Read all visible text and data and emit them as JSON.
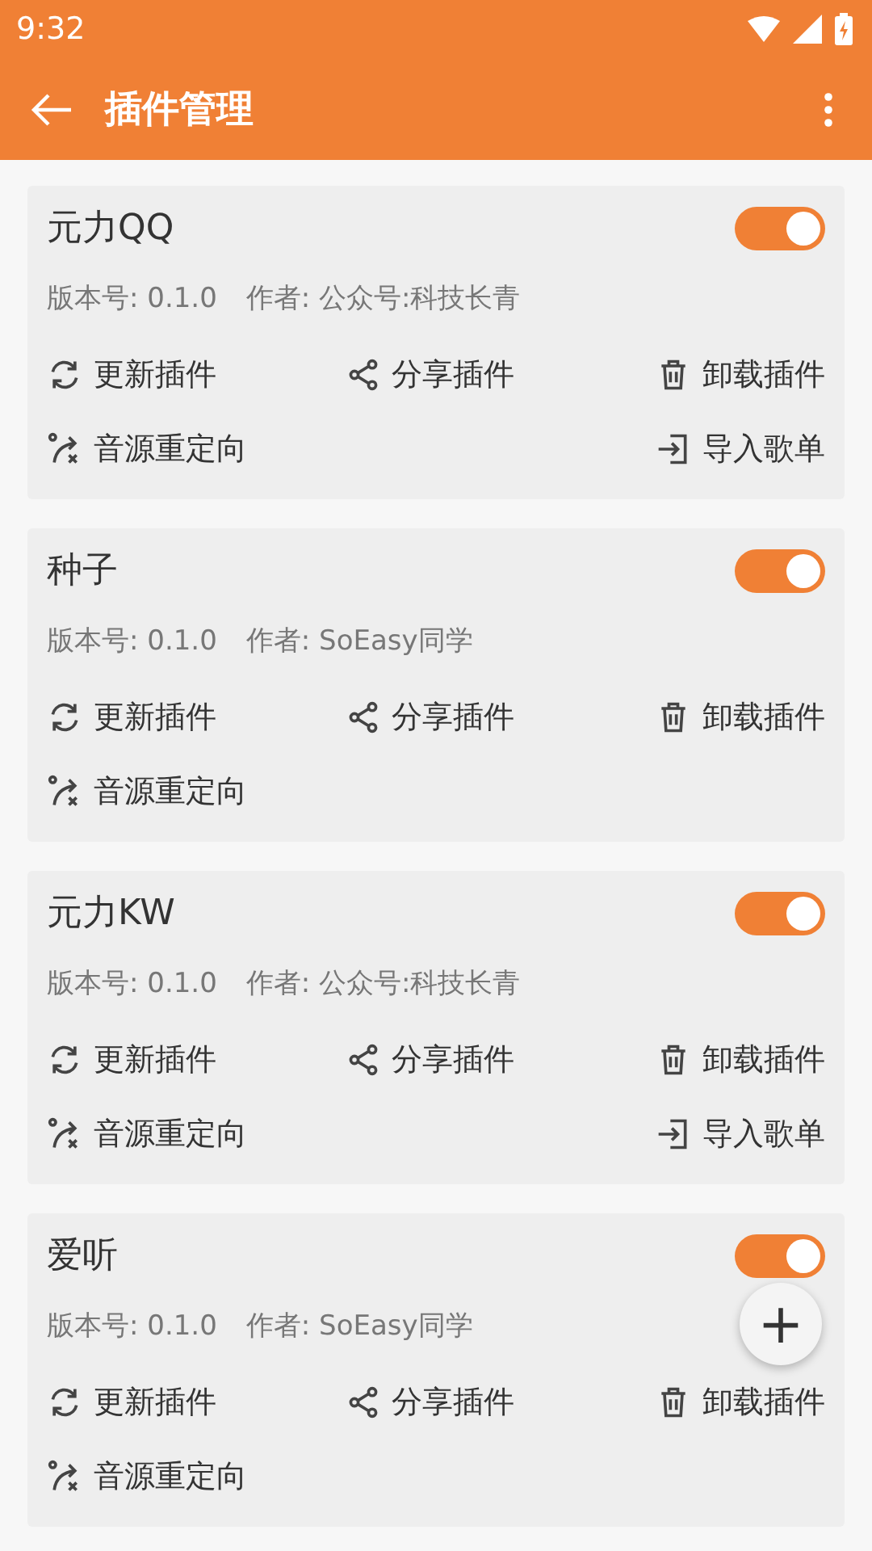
{
  "status_bar": {
    "time": "9:32"
  },
  "app_bar": {
    "title": "插件管理"
  },
  "plugins": [
    {
      "name": "元力QQ",
      "enabled": true,
      "version": "版本号: 0.1.0",
      "author": "作者: 公众号:科技长青",
      "actions": [
        {
          "kind": "update",
          "label": "更新插件"
        },
        {
          "kind": "share",
          "label": "分享插件"
        },
        {
          "kind": "uninstall",
          "label": "卸载插件"
        },
        {
          "kind": "redirect",
          "label": "音源重定向"
        },
        {
          "kind": "import",
          "label": "导入歌单"
        }
      ]
    },
    {
      "name": "种子",
      "enabled": true,
      "version": "版本号: 0.1.0",
      "author": "作者: SoEasy同学",
      "actions": [
        {
          "kind": "update",
          "label": "更新插件"
        },
        {
          "kind": "share",
          "label": "分享插件"
        },
        {
          "kind": "uninstall",
          "label": "卸载插件"
        },
        {
          "kind": "redirect",
          "label": "音源重定向"
        }
      ]
    },
    {
      "name": "元力KW",
      "enabled": true,
      "version": "版本号: 0.1.0",
      "author": "作者: 公众号:科技长青",
      "actions": [
        {
          "kind": "update",
          "label": "更新插件"
        },
        {
          "kind": "share",
          "label": "分享插件"
        },
        {
          "kind": "uninstall",
          "label": "卸载插件"
        },
        {
          "kind": "redirect",
          "label": "音源重定向"
        },
        {
          "kind": "import",
          "label": "导入歌单"
        }
      ]
    },
    {
      "name": "爱听",
      "enabled": true,
      "version": "版本号: 0.1.0",
      "author": "作者: SoEasy同学",
      "actions": [
        {
          "kind": "update",
          "label": "更新插件"
        },
        {
          "kind": "share",
          "label": "分享插件"
        },
        {
          "kind": "uninstall",
          "label": "卸载插件"
        },
        {
          "kind": "redirect",
          "label": "音源重定向"
        }
      ]
    }
  ],
  "fab": {
    "label": "+"
  }
}
